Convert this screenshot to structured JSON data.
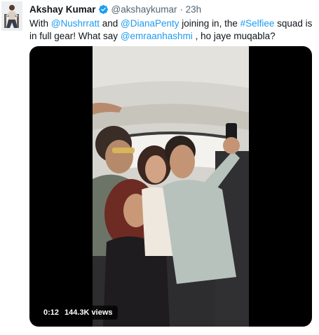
{
  "tweet": {
    "author": {
      "name": "Akshay Kumar",
      "handle": "@akshaykumar",
      "separator": "·",
      "time": "23h"
    },
    "text": {
      "part1": "With ",
      "mention1": "@Nushrratt",
      "part2": " and ",
      "mention2": "@DianaPenty",
      "part3": " joining in, the ",
      "hashtag": "#Selfiee",
      "part4": " squad is in full gear! What say ",
      "mention3": "@emraanhashmi",
      "part5": " , ho jaye muqabla?"
    },
    "media": {
      "timestamp": "0:12",
      "views": "144.3K views"
    }
  },
  "colors": {
    "link": "#1d9bf0",
    "verified": "#1d9bf0",
    "secondary_text": "#536471"
  }
}
